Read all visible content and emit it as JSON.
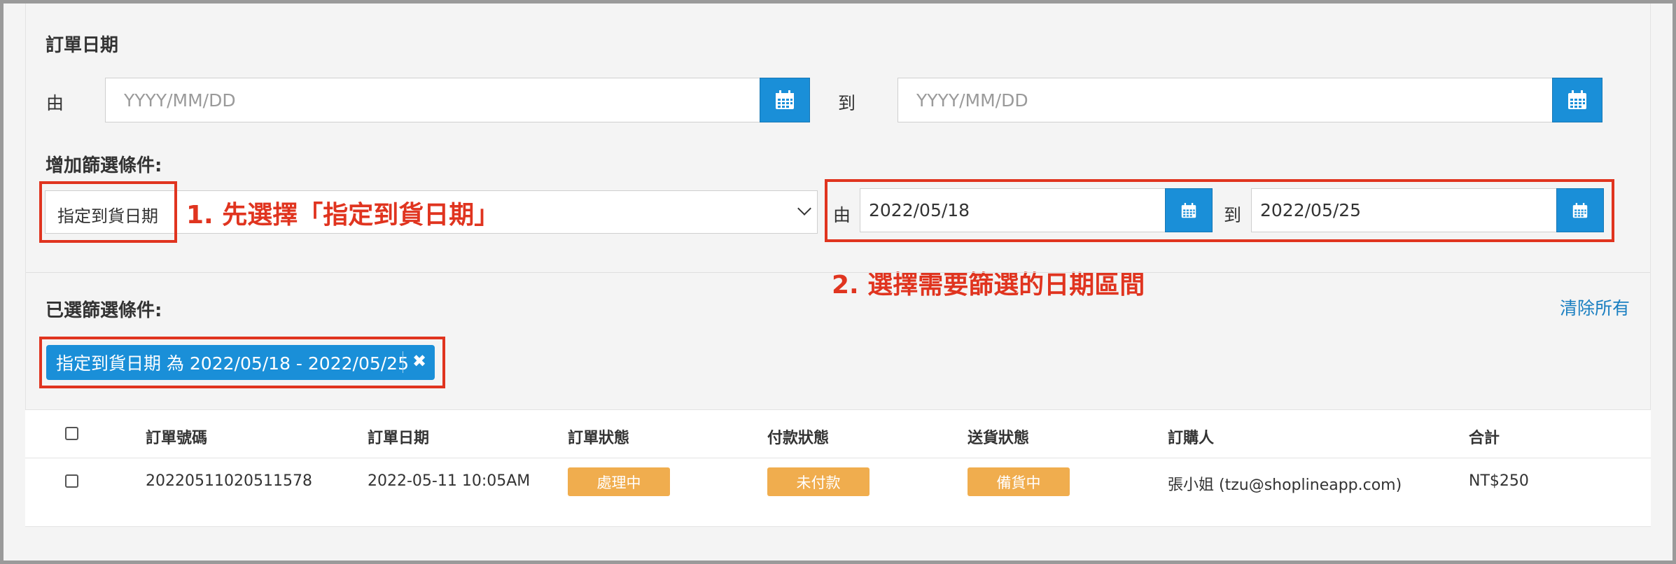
{
  "order_date": {
    "title": "訂單日期",
    "from_label": "由",
    "to_label": "到",
    "from_placeholder": "YYYY/MM/DD",
    "to_placeholder": "YYYY/MM/DD"
  },
  "filter_add": {
    "title": "增加篩選條件:",
    "selected_filter": "指定到貨日期",
    "from_label": "由",
    "to_label": "到",
    "from_value": "2022/05/18",
    "to_value": "2022/05/25"
  },
  "annotations": {
    "step1": "1. 先選擇「指定到貨日期」",
    "step2": "2. 選擇需要篩選的日期區間"
  },
  "selected_filters": {
    "title": "已選篩選條件:",
    "clear_all": "清除所有",
    "chip_text": "指定到貨日期 為 2022/05/18 - 2022/05/25",
    "chip_close": "✖"
  },
  "table": {
    "headers": [
      "訂單號碼",
      "訂單日期",
      "訂單狀態",
      "付款狀態",
      "送貨狀態",
      "訂購人",
      "合計"
    ],
    "rows": [
      {
        "order_number": "20220511020511578",
        "order_date": "2022-05-11 10:05AM",
        "order_status": "處理中",
        "payment_status": "未付款",
        "delivery_status": "備貨中",
        "customer": "張小姐 (tzu@shoplineapp.com)",
        "total": "NT$250"
      }
    ]
  },
  "colors": {
    "accent": "#1a8fd8",
    "annotation": "#e0341f",
    "badge": "#f0ad4e",
    "link": "#1a7fc1"
  }
}
